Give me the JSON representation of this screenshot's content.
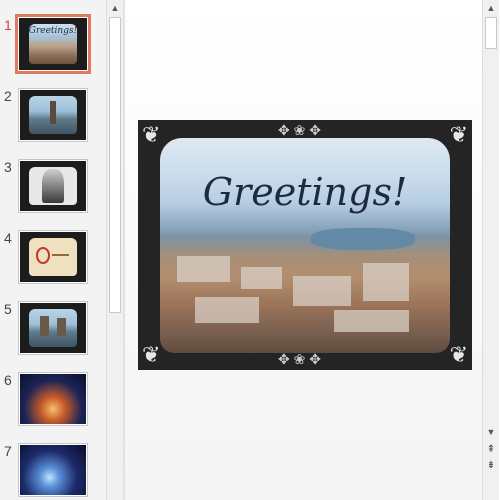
{
  "thumbnails": [
    {
      "number": "1",
      "title": "Greetings!",
      "selected": true,
      "style": "city"
    },
    {
      "number": "2",
      "style": "lake"
    },
    {
      "number": "3",
      "style": "portrait"
    },
    {
      "number": "4",
      "style": "paper"
    },
    {
      "number": "5",
      "style": "lake"
    },
    {
      "number": "6",
      "style": "fountain-night"
    },
    {
      "number": "7",
      "style": "fountain-blue"
    }
  ],
  "slide": {
    "title": "Greetings!"
  },
  "colors": {
    "selected_border": "#e07a5f",
    "selected_number": "#c94a2e",
    "slide_bg": "#242424",
    "title_text": "#1e2a44"
  },
  "icons": {
    "scroll_up": "triangle-up",
    "scroll_down": "triangle-down",
    "prev_slide": "double-chevron-up",
    "next_slide": "double-chevron-down"
  }
}
